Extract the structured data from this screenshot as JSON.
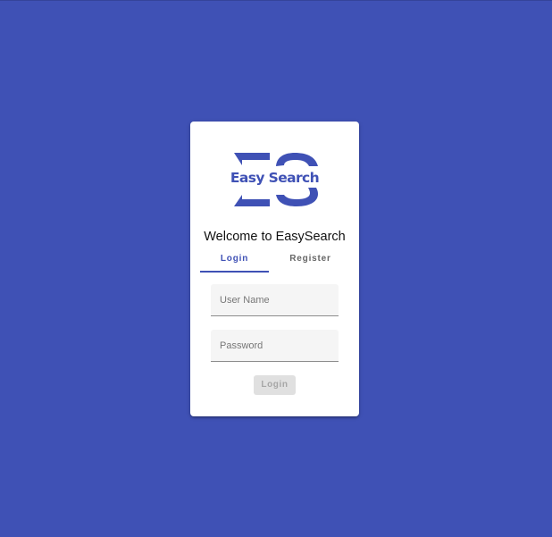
{
  "colors": {
    "background": "#3f51b5",
    "brand": "#3f51b5",
    "card": "#ffffff",
    "field_background": "#f5f5f5",
    "disabled_button": "#e0e0e0"
  },
  "logo": {
    "icon": "easysearch-logo",
    "text": "Easy Search"
  },
  "card": {
    "title": "Welcome to EasySearch"
  },
  "tabs": [
    {
      "label": "Login",
      "active": true
    },
    {
      "label": "Register",
      "active": false
    }
  ],
  "form": {
    "username": {
      "value": "",
      "placeholder": "User Name"
    },
    "password": {
      "value": "",
      "placeholder": "Password"
    },
    "submit_label": "Login",
    "submit_disabled": true
  }
}
